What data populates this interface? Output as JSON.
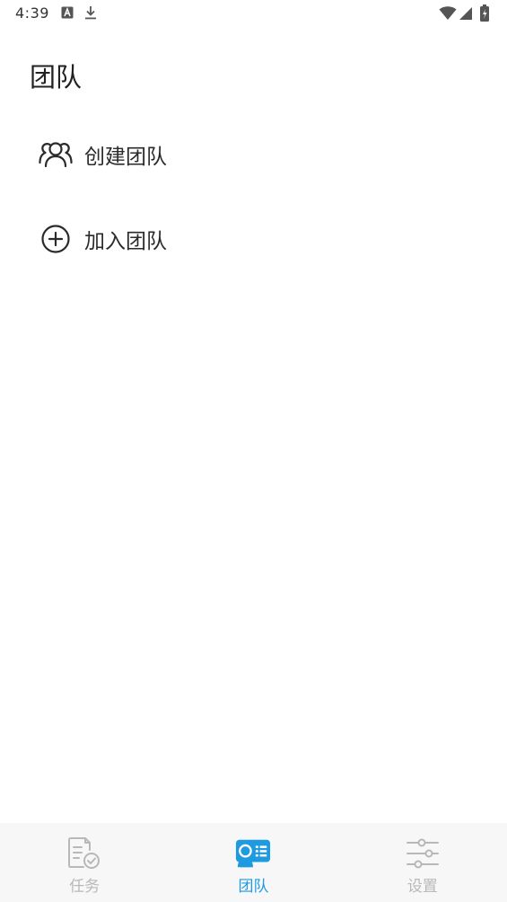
{
  "status_bar": {
    "time": "4:39",
    "icons": [
      "a-badge-icon",
      "download-icon",
      "wifi-icon",
      "signal-icon",
      "battery-charging-icon"
    ]
  },
  "page": {
    "title": "团队"
  },
  "menu": {
    "items": [
      {
        "label": "创建团队",
        "icon": "group-icon"
      },
      {
        "label": "加入团队",
        "icon": "plus-circle-icon"
      }
    ]
  },
  "bottom_nav": {
    "active_index": 1,
    "active_color": "#1e9be0",
    "inactive_color": "#b8b8b8",
    "tabs": [
      {
        "label": "任务",
        "icon": "task-document-icon"
      },
      {
        "label": "团队",
        "icon": "team-card-icon"
      },
      {
        "label": "设置",
        "icon": "sliders-icon"
      }
    ]
  }
}
